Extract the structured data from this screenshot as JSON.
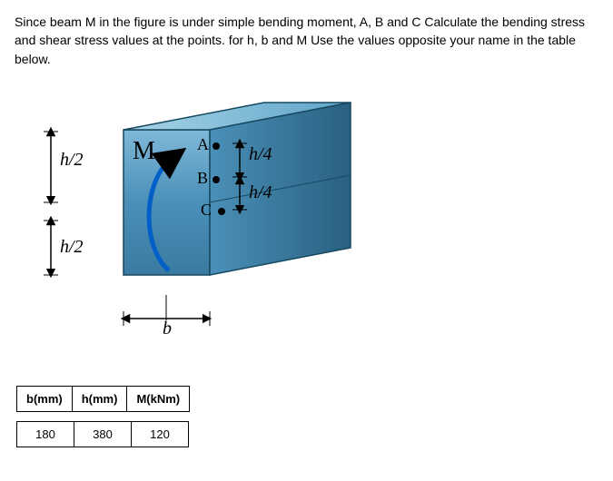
{
  "problem": {
    "text": "Since beam M in the figure is under simple bending moment, A, B and C Calculate the bending stress and shear stress values at the points. for h, b and M Use the values opposite your name in the table below."
  },
  "figure": {
    "moment_label": "M",
    "points": {
      "A": "A",
      "B": "B",
      "C": "C"
    },
    "dims": {
      "h_half_upper": "h/2",
      "h_half_lower": "h/2",
      "h_quarter_AB": "h/4",
      "h_quarter_BC": "h/4",
      "b_label": "b"
    }
  },
  "table": {
    "headers": {
      "b": "b(mm)",
      "h": "h(mm)",
      "M": "M(kNm)"
    },
    "row": {
      "b": "180",
      "h": "380",
      "M": "120"
    }
  }
}
